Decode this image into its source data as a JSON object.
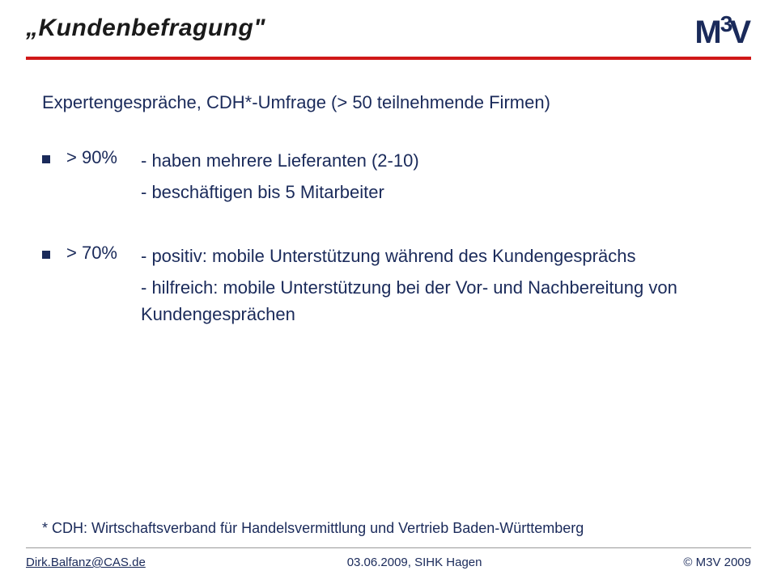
{
  "header": {
    "title": "„Kundenbefragung\"",
    "logo": {
      "m": "M",
      "three": "3",
      "v": "V"
    }
  },
  "content": {
    "subtitle": "Expertengespräche, CDH*-Umfrage (> 50 teilnehmende Firmen)",
    "bullets": [
      {
        "pct": "> 90%",
        "lines": [
          "- haben mehrere Lieferanten (2-10)",
          "- beschäftigen bis 5 Mitarbeiter"
        ]
      },
      {
        "pct": "> 70%",
        "lines": [
          "- positiv: mobile Unterstützung während des Kundengesprächs",
          "- hilfreich: mobile Unterstützung bei der Vor- und Nachbereitung von Kundengesprächen"
        ]
      }
    ],
    "footnote": "* CDH: Wirtschaftsverband für Handelsvermittlung und Vertrieb Baden-Württemberg"
  },
  "footer": {
    "left": "Dirk.Balfanz@CAS.de",
    "center": "03.06.2009, SIHK Hagen",
    "right": "© M3V 2009"
  }
}
